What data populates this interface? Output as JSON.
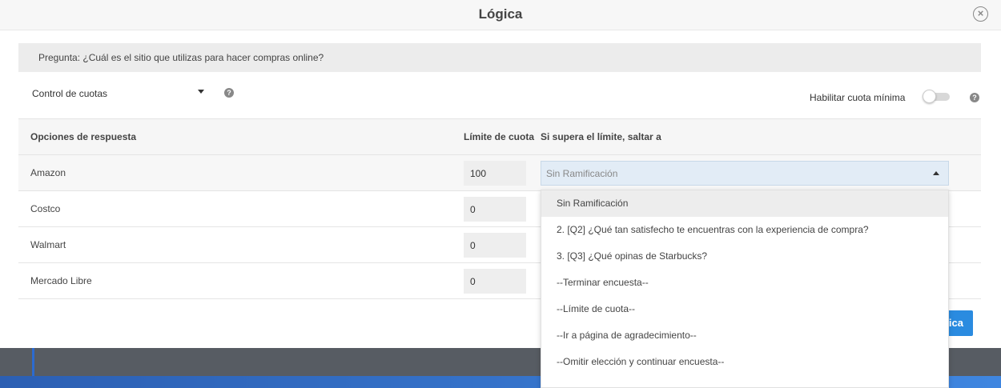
{
  "modal": {
    "title": "Lógica",
    "close_icon": "close-circle-icon"
  },
  "question": {
    "text": "Pregunta: ¿Cuál es el sitio que utilizas para hacer compras online?"
  },
  "controls": {
    "quota_mode": "Control de cuotas",
    "help_icon": "question-circle-icon",
    "min_quota_label": "Habilitar cuota mínima",
    "min_quota_enabled": false
  },
  "table": {
    "headers": {
      "options": "Opciones de respuesta",
      "limit": "Límite de cuota",
      "jump": "Si supera el límite, saltar a"
    },
    "rows": [
      {
        "label": "Amazon",
        "limit": "100"
      },
      {
        "label": "Costco",
        "limit": "0"
      },
      {
        "label": "Walmart",
        "limit": "0"
      },
      {
        "label": "Mercado Libre",
        "limit": "0"
      }
    ]
  },
  "branch": {
    "selected": "Sin Ramificación",
    "options": [
      "Sin Ramificación",
      "2. [Q2] ¿Qué tan satisfecho te encuentras con la experiencia de compra?",
      "3. [Q3] ¿Qué opinas de Starbucks?",
      "--Terminar encuesta--",
      "--Límite de cuota--",
      "--Ir a página de agradecimiento--",
      "--Omitir elección y continuar encuesta--"
    ]
  },
  "footer": {
    "primary_visible_text": "ica"
  },
  "colors": {
    "primary": "#2a8be0",
    "select_bg": "#e2ecf6",
    "backdrop": "#575c63"
  }
}
